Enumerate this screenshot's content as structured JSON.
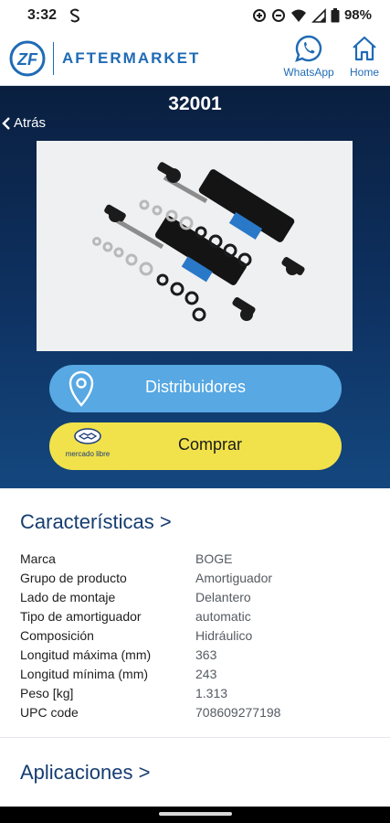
{
  "status_bar": {
    "time": "3:32",
    "battery": "98%",
    "icons": [
      "s-notification-icon",
      "data-saver-icon",
      "do-not-disturb-icon",
      "wifi-icon",
      "signal-icon",
      "battery-icon"
    ]
  },
  "header": {
    "logo_text": "ZF",
    "brand": "AFTERMARKET",
    "whatsapp_label": "WhatsApp",
    "home_label": "Home"
  },
  "product": {
    "code": "32001",
    "back_label": "Atrás"
  },
  "actions": {
    "distribuidores_label": "Distribuidores",
    "comprar_label": "Comprar",
    "mercado_libre_text": "mercado libre"
  },
  "characteristics": {
    "title": "Características >",
    "rows": [
      {
        "label": "Marca",
        "value": "BOGE"
      },
      {
        "label": "Grupo de producto",
        "value": "Amortiguador"
      },
      {
        "label": "Lado de montaje",
        "value": "Delantero"
      },
      {
        "label": "Tipo de amortiguador",
        "value": "automatic"
      },
      {
        "label": "Composición",
        "value": "Hidráulico"
      },
      {
        "label": "Longitud máxima (mm)",
        "value": "363"
      },
      {
        "label": "Longitud mínima (mm)",
        "value": "243"
      },
      {
        "label": "Peso [kg]",
        "value": "1.313"
      },
      {
        "label": "UPC code",
        "value": "708609277198"
      }
    ]
  },
  "applications": {
    "title": "Aplicaciones >"
  },
  "colors": {
    "brand_blue": "#1f6bb5",
    "hero_dark": "#0a1f40",
    "distribuidores_button": "#57a8e3",
    "comprar_button": "#f1e24b",
    "section_title": "#163d71"
  }
}
